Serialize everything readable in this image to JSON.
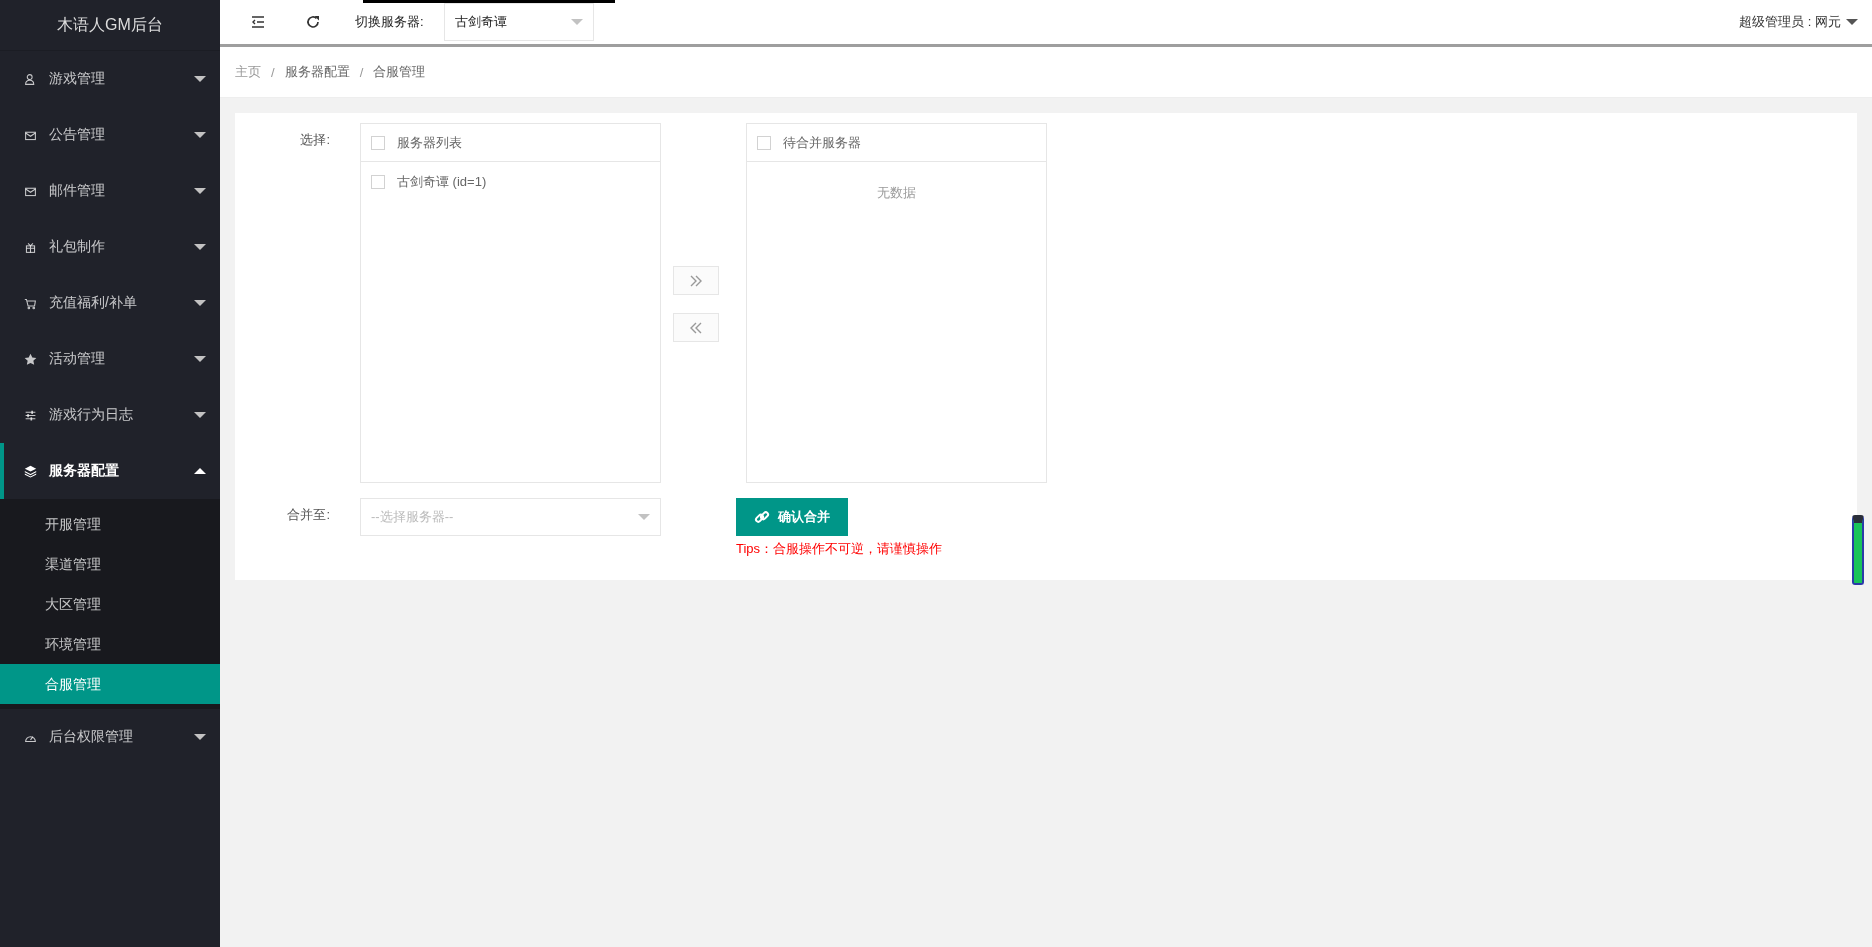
{
  "sidebar": {
    "logo": "木语人GM后台",
    "items": [
      {
        "label": "游戏管理",
        "kind": "user",
        "expanded": false,
        "selected": false
      },
      {
        "label": "公告管理",
        "kind": "mail",
        "expanded": false,
        "selected": false
      },
      {
        "label": "邮件管理",
        "kind": "mail",
        "expanded": false,
        "selected": false
      },
      {
        "label": "礼包制作",
        "kind": "gift",
        "expanded": false,
        "selected": false
      },
      {
        "label": "充值福利/补单",
        "kind": "cart",
        "expanded": false,
        "selected": false
      },
      {
        "label": "活动管理",
        "kind": "star",
        "expanded": false,
        "selected": false
      },
      {
        "label": "游戏行为日志",
        "kind": "sliders",
        "expanded": false,
        "selected": false
      },
      {
        "label": "服务器配置",
        "kind": "layers",
        "expanded": true,
        "selected": true,
        "children": [
          {
            "label": "开服管理",
            "selected": false
          },
          {
            "label": "渠道管理",
            "selected": false
          },
          {
            "label": "大区管理",
            "selected": false
          },
          {
            "label": "环境管理",
            "selected": false
          },
          {
            "label": "合服管理",
            "selected": true
          }
        ]
      },
      {
        "label": "后台权限管理",
        "kind": "gauge",
        "expanded": false,
        "selected": false
      }
    ]
  },
  "header": {
    "server_label": "切换服务器:",
    "server_value": "古剑奇谭",
    "user": "超级管理员 : 网元"
  },
  "breadcrumb": {
    "separator": "/",
    "items": [
      "主页",
      "服务器配置",
      "合服管理"
    ]
  },
  "form": {
    "select_label": "选择:",
    "source_list": {
      "title": "服务器列表",
      "checked": false,
      "items": [
        {
          "label": "古剑奇谭 (id=1)",
          "checked": false
        }
      ]
    },
    "target_list": {
      "title": "待合并服务器",
      "checked": false,
      "empty_text": "无数据"
    },
    "move_right": {
      "disabled": true
    },
    "move_left": {
      "disabled": true
    },
    "merge_label": "合并至:",
    "merge_select": {
      "placeholder": "--选择服务器--"
    },
    "confirm_button": "确认合并",
    "tips": "Tips：合服操作不可逆，请谨慎操作"
  }
}
